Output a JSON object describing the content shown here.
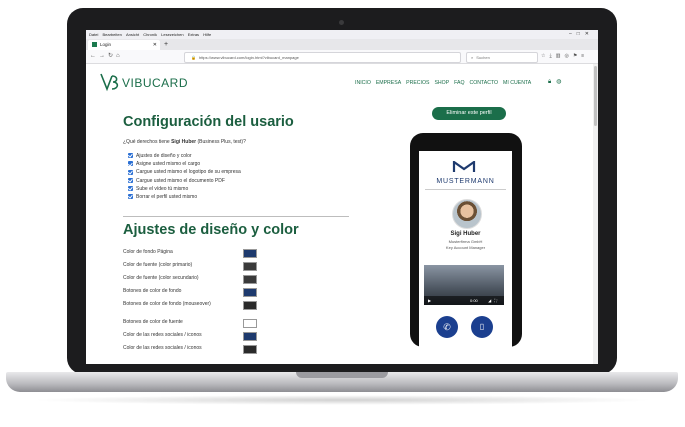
{
  "browser": {
    "menu": [
      "Datei",
      "Bearbeiten",
      "Ansicht",
      "Chronik",
      "Lesezeichen",
      "Extras",
      "Hilfe"
    ],
    "tab_title": "Login",
    "url": "https://www.vibucard.com/login.html?vibucard_manpage",
    "search_placeholder": "Suchen"
  },
  "site": {
    "logo_text": "VIBUCARD",
    "nav": [
      "INICIO",
      "EMPRESA",
      "PRECIOS",
      "SHOP",
      "FAQ",
      "CONTACTO",
      "MI CUENTA"
    ]
  },
  "settings": {
    "title": "Configuración del usario",
    "question_prefix": "¿Qué derechos tiene ",
    "user_name": "Sigi Huber",
    "question_suffix": " (Business Plus, test)?",
    "permissions": [
      "Ajustes de diseño y color",
      "Asigne usted mismo el cargo",
      "Cargue usted mismo el logotipo de su empresa",
      "Cargue usted mismo el documento PDF",
      "Sube el vídeo tú mismo",
      "Borrar el perfil usted mismo"
    ]
  },
  "design": {
    "title": "Ajustes de diseño y color",
    "colors": [
      {
        "label": "Color de fondo Página",
        "color": "#1e3a6e"
      },
      {
        "label": "Color de fuente (color primario)",
        "color": "#3a3a3a"
      },
      {
        "label": "Color de fuente (color secundario)",
        "color": "#3a3a3a"
      },
      {
        "label": "Botones de color de fondo",
        "color": "#1e3a6e"
      },
      {
        "label": "Botones de color de fondo (mouseover)",
        "color": "#2a2a2a"
      },
      {
        "label": "Botones de color de fuente",
        "color": "#ffffff"
      },
      {
        "label": "Color de las redes sociales / iconos",
        "color": "#1e3a6e"
      },
      {
        "label": "Color de las redes sociales / iconos",
        "color": "#2a2a2a"
      }
    ]
  },
  "actions": {
    "delete_profile": "Eliminar este perfil"
  },
  "phone_preview": {
    "brand": "MUSTERMANN",
    "name": "Sigi Huber",
    "company": "Musterfirma GmbH",
    "job_title": "Key Account Manager",
    "video_time": "0:00"
  }
}
